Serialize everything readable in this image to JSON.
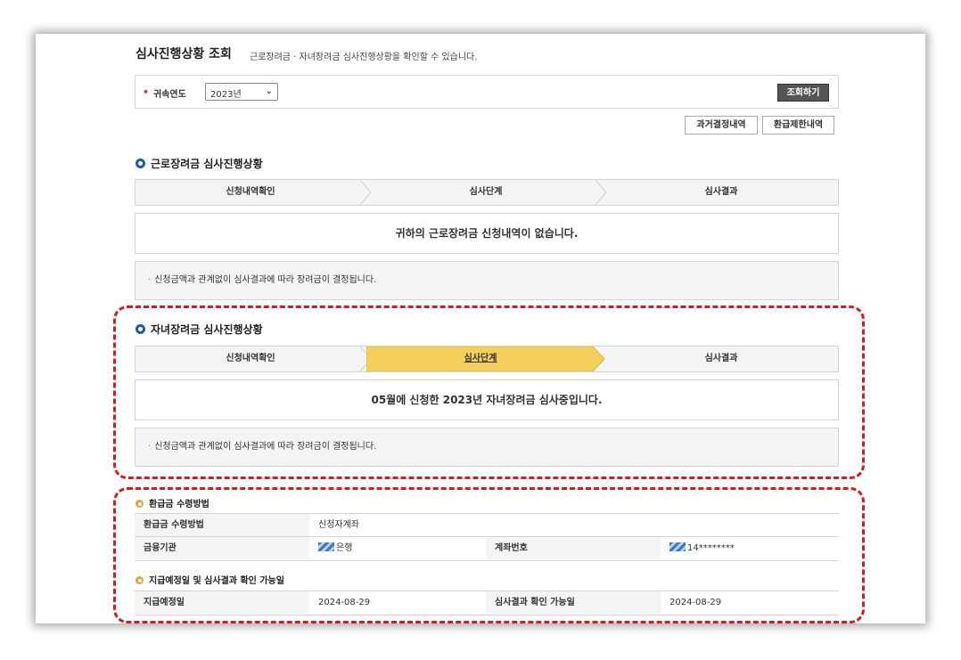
{
  "header": {
    "title": "심사진행상황 조회",
    "subtitle": "근로장려금 · 자녀장려금 심사진행상황을 확인할 수 있습니다."
  },
  "filter": {
    "bullet": "•",
    "label": "귀속연도",
    "year_value": "2023년",
    "search_button": "조회하기"
  },
  "actions": {
    "past_decisions": "과거결정내역",
    "refund_limits": "환급제한내역"
  },
  "work_incentive": {
    "title": "근로장려금 심사진행상황",
    "steps": [
      "신청내역확인",
      "심사단계",
      "심사결과"
    ],
    "active_step": -1,
    "message": "귀하의 근로장려금 신청내역이 없습니다.",
    "note": "신청금액과 관계없이 심사결과에 따라 장려금이 결정됩니다."
  },
  "child_incentive": {
    "title": "자녀장려금 심사진행상황",
    "steps": [
      "신청내역확인",
      "심사단계",
      "심사결과"
    ],
    "active_step": 1,
    "message": "05월에 신청한 2023년 자녀장려금 심사중입니다.",
    "note": "신청금액과 관계없이 심사결과에 따라 장려금이 결정됩니다."
  },
  "refund_method": {
    "title": "환급금 수령방법",
    "method_label": "환급금 수령방법",
    "method_value": "신청자계좌",
    "bank_label": "금융기관",
    "bank_value": "은행",
    "account_label": "계좌번호",
    "account_value": "14********"
  },
  "schedule": {
    "title": "지급예정일 및 심사결과 확인 가능일",
    "pay_label": "지급예정일",
    "pay_value": "2024-08-29",
    "result_label": "심사결과 확인 가능일",
    "result_value": "2024-08-29"
  },
  "colors": {
    "accent_blue": "#1f5aa7",
    "active_step": "#f4cf5b",
    "highlight_dash": "#e01818",
    "subsection_dot": "#e8a13a"
  }
}
